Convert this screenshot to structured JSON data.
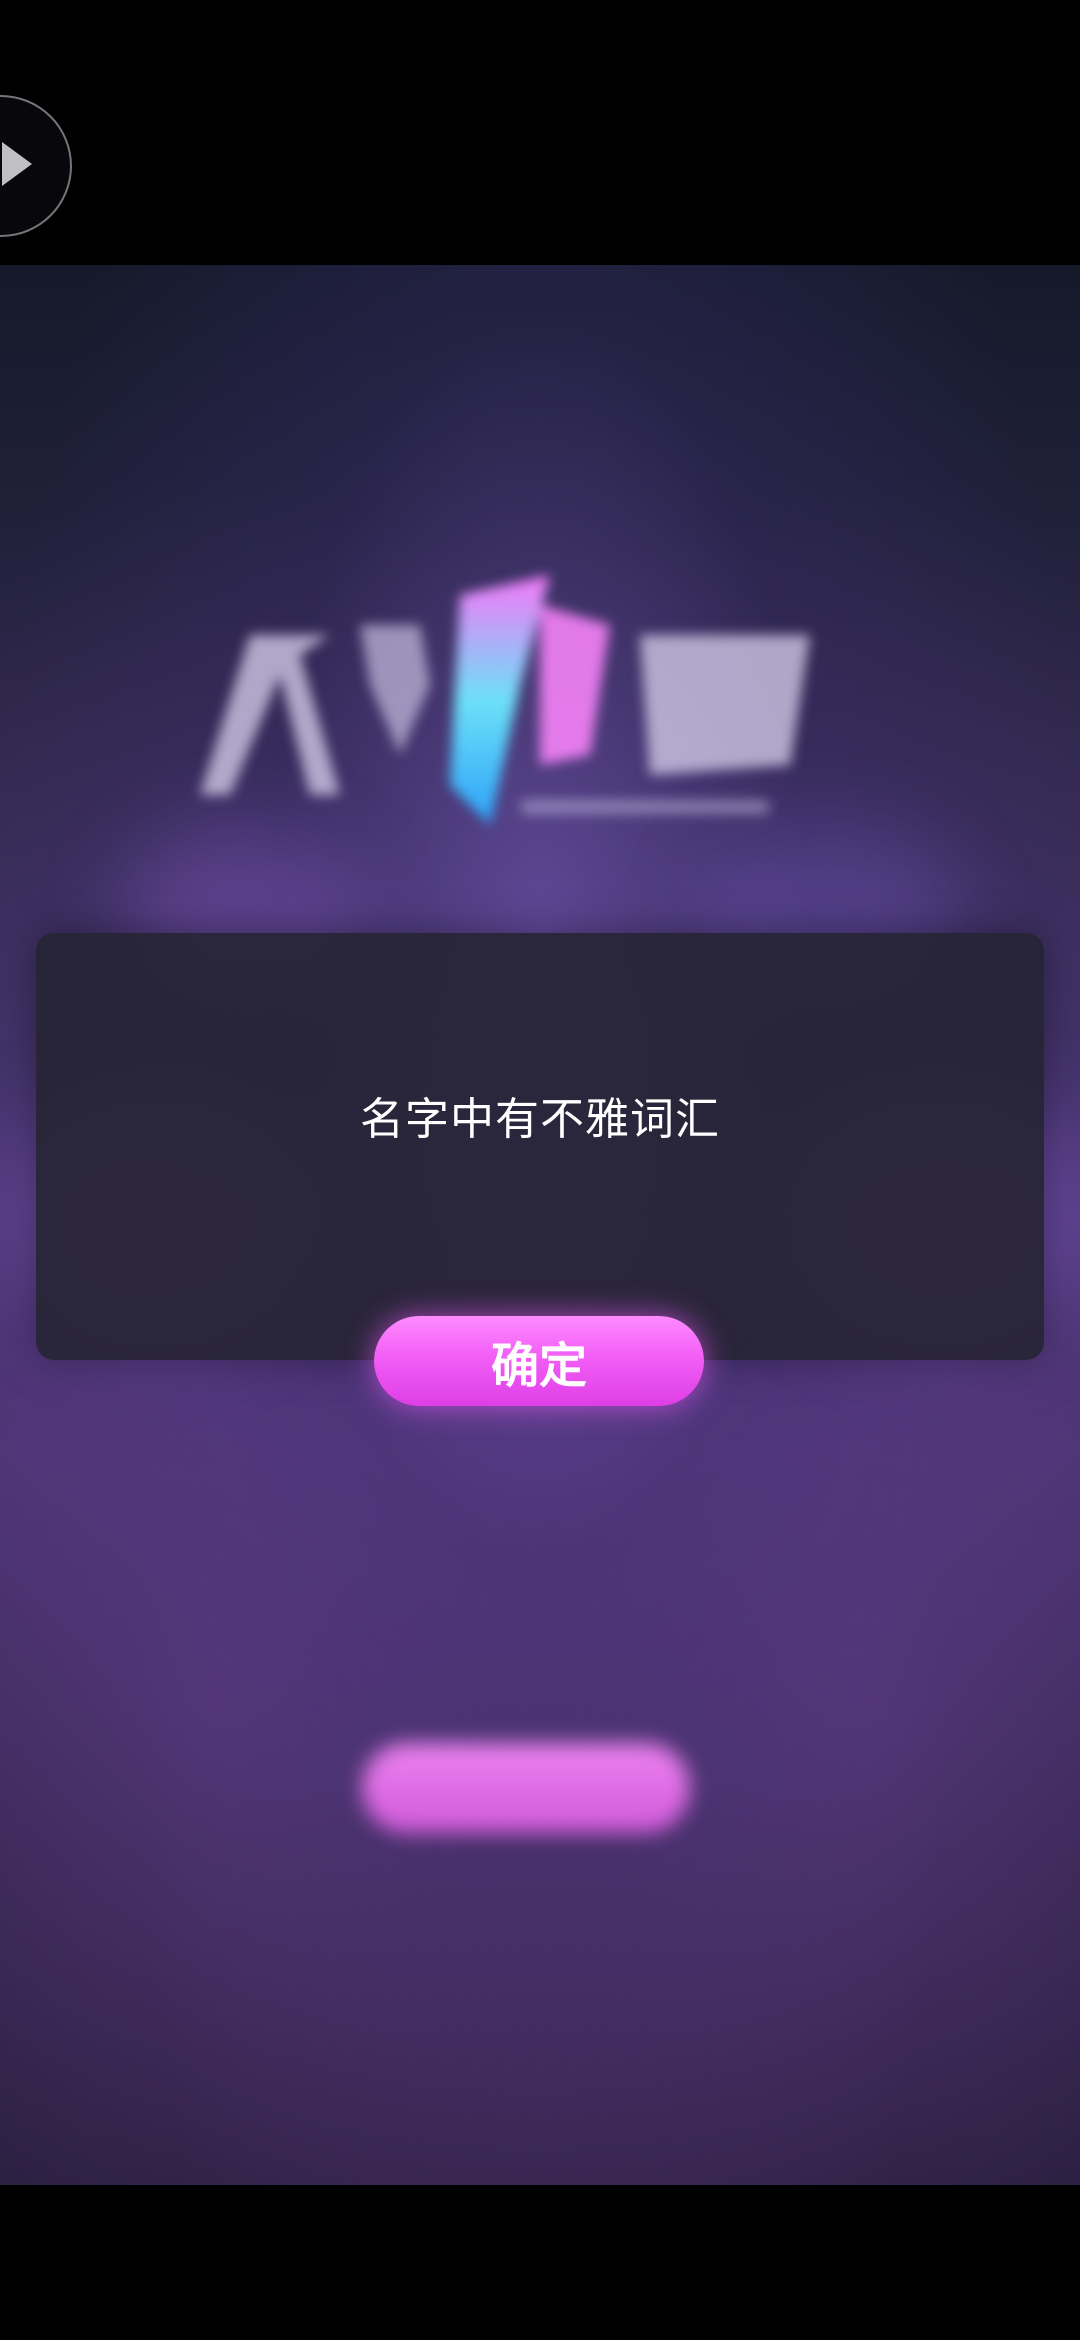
{
  "dialog": {
    "message": "名字中有不雅词汇",
    "confirm_label": "确定"
  },
  "colors": {
    "accent": "#f25ef6",
    "dialog_bg": "#262434",
    "text": "#ffffff"
  },
  "icons": {
    "play": "play-icon"
  }
}
